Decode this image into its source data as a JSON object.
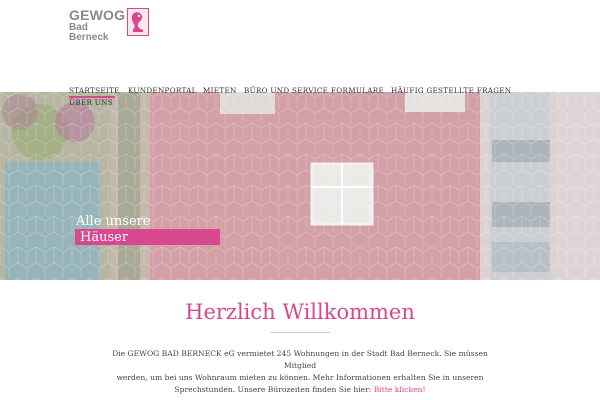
{
  "logo": {
    "line1": "GEWOG",
    "line2": "Bad Berneck",
    "brand_color": "#d9488f"
  },
  "nav": {
    "items": [
      {
        "label": "STARTSEITE",
        "active": true
      },
      {
        "label": "KUNDENPORTAL"
      },
      {
        "label": "MIETEN"
      },
      {
        "label": "BÜRO UND SERVICE"
      },
      {
        "label": "FORMULARE"
      },
      {
        "label": "HÄUFIG GESTELLTE FRAGEN"
      },
      {
        "label": "ÜBER UNS"
      }
    ]
  },
  "hero": {
    "caption_line1": "Alle unsere",
    "caption_line2": "Häuser"
  },
  "main": {
    "title": "Herzlich Willkommen",
    "intro_line1": "Die GEWOG BAD BERNECK eG vermietet 245 Wohnungen in der Stadt Bad Berneck. Sie müssen Mitglied",
    "intro_line2": "werden, um bei uns Wohnraum mieten zu können. Mehr Informationen erhalten Sie  in unseren",
    "intro_line3": "Sprechstunden. Unsere Bürozeiten finden Sie hier:",
    "intro_link": "Bitte klicken!"
  }
}
